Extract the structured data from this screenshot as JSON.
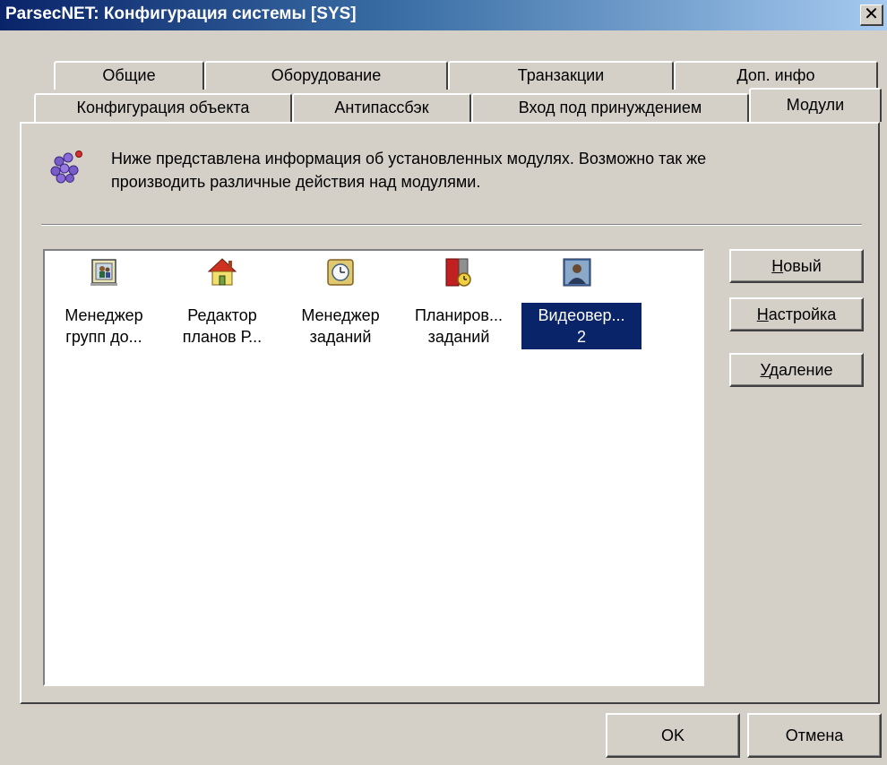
{
  "window": {
    "title": "ParsecNET: Конфигурация системы [SYS]",
    "close_glyph": "✕"
  },
  "tabs": {
    "back_row": [
      {
        "label": "Общие"
      },
      {
        "label": "Оборудование"
      },
      {
        "label": "Транзакции"
      },
      {
        "label": "Доп. инфо"
      }
    ],
    "front_row": [
      {
        "label": "Конфигурация объекта"
      },
      {
        "label": "Антипассбэк"
      },
      {
        "label": "Вход под принуждением"
      },
      {
        "label": "Модули",
        "active": true
      }
    ]
  },
  "info": {
    "line1": "Ниже представлена информация об установленных модулях. Возможно так же",
    "line2": "производить различные действия над модулями."
  },
  "modules": [
    {
      "line1": "Менеджер",
      "line2": "групп до...",
      "icon": "group-manager-icon"
    },
    {
      "line1": "Редактор",
      "line2": "планов Р...",
      "icon": "house-icon"
    },
    {
      "line1": "Менеджер",
      "line2": "заданий",
      "icon": "task-manager-clock-icon"
    },
    {
      "line1": "Планиров...",
      "line2": "заданий",
      "icon": "scheduler-door-clock-icon"
    },
    {
      "line1": "Видеовер...",
      "line2": "2",
      "icon": "video-verification-person-icon",
      "selected": true
    }
  ],
  "side_buttons": {
    "new": {
      "accel": "Н",
      "rest": "овый"
    },
    "settings": {
      "accel": "Н",
      "rest": "астройка"
    },
    "delete": {
      "accel": "У",
      "rest": "даление"
    }
  },
  "bottom_buttons": {
    "ok": "OK",
    "cancel": "Отмена"
  },
  "colors": {
    "selection": "#0a246a",
    "titlebar_start": "#0a246a",
    "titlebar_end": "#a6caf0",
    "face": "#d4d0c8"
  }
}
